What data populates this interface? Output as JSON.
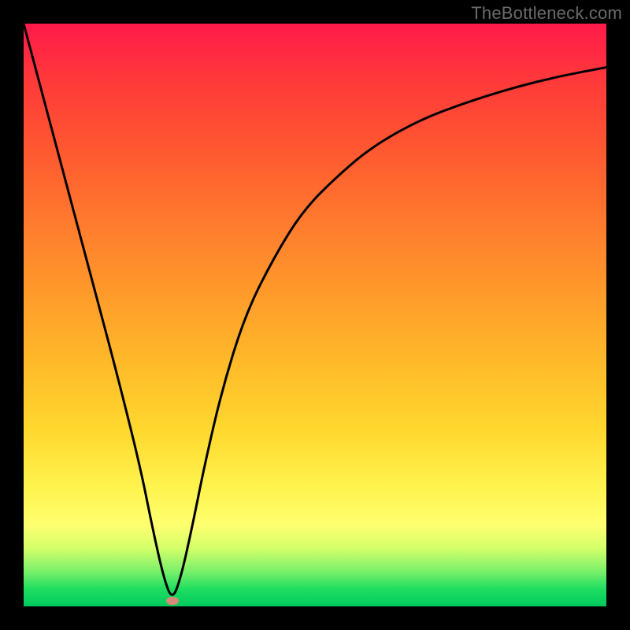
{
  "watermark": "TheBottleneck.com",
  "chart_data": {
    "type": "line",
    "title": "",
    "xlabel": "",
    "ylabel": "",
    "xlim": [
      0,
      100
    ],
    "ylim": [
      0,
      100
    ],
    "series": [
      {
        "name": "curve",
        "x": [
          0,
          4,
          8,
          12,
          16,
          20,
          22,
          24,
          25.5,
          27,
          29,
          31,
          34,
          38,
          43,
          48,
          54,
          60,
          68,
          76,
          84,
          92,
          100
        ],
        "values": [
          100,
          85,
          70,
          55,
          40,
          24,
          14,
          5,
          1,
          5,
          14,
          24,
          37,
          50,
          60,
          68,
          74,
          79,
          83.5,
          86.5,
          89,
          91,
          92.5
        ]
      }
    ],
    "marker": {
      "x": 25.5,
      "y": 1
    },
    "gradient_stops": [
      {
        "pos": 0,
        "color": "#ff1a4a"
      },
      {
        "pos": 50,
        "color": "#ffb92a"
      },
      {
        "pos": 85,
        "color": "#ffff70"
      },
      {
        "pos": 100,
        "color": "#00c95e"
      }
    ]
  }
}
